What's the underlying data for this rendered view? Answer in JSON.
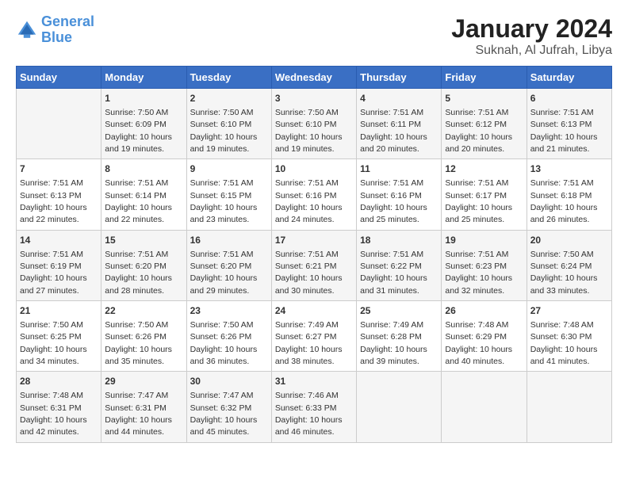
{
  "logo": {
    "line1": "General",
    "line2": "Blue"
  },
  "title": "January 2024",
  "subtitle": "Suknah, Al Jufrah, Libya",
  "days_header": [
    "Sunday",
    "Monday",
    "Tuesday",
    "Wednesday",
    "Thursday",
    "Friday",
    "Saturday"
  ],
  "weeks": [
    [
      {
        "day": "",
        "sunrise": "",
        "sunset": "",
        "daylight": ""
      },
      {
        "day": "1",
        "sunrise": "Sunrise: 7:50 AM",
        "sunset": "Sunset: 6:09 PM",
        "daylight": "Daylight: 10 hours and 19 minutes."
      },
      {
        "day": "2",
        "sunrise": "Sunrise: 7:50 AM",
        "sunset": "Sunset: 6:10 PM",
        "daylight": "Daylight: 10 hours and 19 minutes."
      },
      {
        "day": "3",
        "sunrise": "Sunrise: 7:50 AM",
        "sunset": "Sunset: 6:10 PM",
        "daylight": "Daylight: 10 hours and 19 minutes."
      },
      {
        "day": "4",
        "sunrise": "Sunrise: 7:51 AM",
        "sunset": "Sunset: 6:11 PM",
        "daylight": "Daylight: 10 hours and 20 minutes."
      },
      {
        "day": "5",
        "sunrise": "Sunrise: 7:51 AM",
        "sunset": "Sunset: 6:12 PM",
        "daylight": "Daylight: 10 hours and 20 minutes."
      },
      {
        "day": "6",
        "sunrise": "Sunrise: 7:51 AM",
        "sunset": "Sunset: 6:13 PM",
        "daylight": "Daylight: 10 hours and 21 minutes."
      }
    ],
    [
      {
        "day": "7",
        "sunrise": "Sunrise: 7:51 AM",
        "sunset": "Sunset: 6:13 PM",
        "daylight": "Daylight: 10 hours and 22 minutes."
      },
      {
        "day": "8",
        "sunrise": "Sunrise: 7:51 AM",
        "sunset": "Sunset: 6:14 PM",
        "daylight": "Daylight: 10 hours and 22 minutes."
      },
      {
        "day": "9",
        "sunrise": "Sunrise: 7:51 AM",
        "sunset": "Sunset: 6:15 PM",
        "daylight": "Daylight: 10 hours and 23 minutes."
      },
      {
        "day": "10",
        "sunrise": "Sunrise: 7:51 AM",
        "sunset": "Sunset: 6:16 PM",
        "daylight": "Daylight: 10 hours and 24 minutes."
      },
      {
        "day": "11",
        "sunrise": "Sunrise: 7:51 AM",
        "sunset": "Sunset: 6:16 PM",
        "daylight": "Daylight: 10 hours and 25 minutes."
      },
      {
        "day": "12",
        "sunrise": "Sunrise: 7:51 AM",
        "sunset": "Sunset: 6:17 PM",
        "daylight": "Daylight: 10 hours and 25 minutes."
      },
      {
        "day": "13",
        "sunrise": "Sunrise: 7:51 AM",
        "sunset": "Sunset: 6:18 PM",
        "daylight": "Daylight: 10 hours and 26 minutes."
      }
    ],
    [
      {
        "day": "14",
        "sunrise": "Sunrise: 7:51 AM",
        "sunset": "Sunset: 6:19 PM",
        "daylight": "Daylight: 10 hours and 27 minutes."
      },
      {
        "day": "15",
        "sunrise": "Sunrise: 7:51 AM",
        "sunset": "Sunset: 6:20 PM",
        "daylight": "Daylight: 10 hours and 28 minutes."
      },
      {
        "day": "16",
        "sunrise": "Sunrise: 7:51 AM",
        "sunset": "Sunset: 6:20 PM",
        "daylight": "Daylight: 10 hours and 29 minutes."
      },
      {
        "day": "17",
        "sunrise": "Sunrise: 7:51 AM",
        "sunset": "Sunset: 6:21 PM",
        "daylight": "Daylight: 10 hours and 30 minutes."
      },
      {
        "day": "18",
        "sunrise": "Sunrise: 7:51 AM",
        "sunset": "Sunset: 6:22 PM",
        "daylight": "Daylight: 10 hours and 31 minutes."
      },
      {
        "day": "19",
        "sunrise": "Sunrise: 7:51 AM",
        "sunset": "Sunset: 6:23 PM",
        "daylight": "Daylight: 10 hours and 32 minutes."
      },
      {
        "day": "20",
        "sunrise": "Sunrise: 7:50 AM",
        "sunset": "Sunset: 6:24 PM",
        "daylight": "Daylight: 10 hours and 33 minutes."
      }
    ],
    [
      {
        "day": "21",
        "sunrise": "Sunrise: 7:50 AM",
        "sunset": "Sunset: 6:25 PM",
        "daylight": "Daylight: 10 hours and 34 minutes."
      },
      {
        "day": "22",
        "sunrise": "Sunrise: 7:50 AM",
        "sunset": "Sunset: 6:26 PM",
        "daylight": "Daylight: 10 hours and 35 minutes."
      },
      {
        "day": "23",
        "sunrise": "Sunrise: 7:50 AM",
        "sunset": "Sunset: 6:26 PM",
        "daylight": "Daylight: 10 hours and 36 minutes."
      },
      {
        "day": "24",
        "sunrise": "Sunrise: 7:49 AM",
        "sunset": "Sunset: 6:27 PM",
        "daylight": "Daylight: 10 hours and 38 minutes."
      },
      {
        "day": "25",
        "sunrise": "Sunrise: 7:49 AM",
        "sunset": "Sunset: 6:28 PM",
        "daylight": "Daylight: 10 hours and 39 minutes."
      },
      {
        "day": "26",
        "sunrise": "Sunrise: 7:48 AM",
        "sunset": "Sunset: 6:29 PM",
        "daylight": "Daylight: 10 hours and 40 minutes."
      },
      {
        "day": "27",
        "sunrise": "Sunrise: 7:48 AM",
        "sunset": "Sunset: 6:30 PM",
        "daylight": "Daylight: 10 hours and 41 minutes."
      }
    ],
    [
      {
        "day": "28",
        "sunrise": "Sunrise: 7:48 AM",
        "sunset": "Sunset: 6:31 PM",
        "daylight": "Daylight: 10 hours and 42 minutes."
      },
      {
        "day": "29",
        "sunrise": "Sunrise: 7:47 AM",
        "sunset": "Sunset: 6:31 PM",
        "daylight": "Daylight: 10 hours and 44 minutes."
      },
      {
        "day": "30",
        "sunrise": "Sunrise: 7:47 AM",
        "sunset": "Sunset: 6:32 PM",
        "daylight": "Daylight: 10 hours and 45 minutes."
      },
      {
        "day": "31",
        "sunrise": "Sunrise: 7:46 AM",
        "sunset": "Sunset: 6:33 PM",
        "daylight": "Daylight: 10 hours and 46 minutes."
      },
      {
        "day": "",
        "sunrise": "",
        "sunset": "",
        "daylight": ""
      },
      {
        "day": "",
        "sunrise": "",
        "sunset": "",
        "daylight": ""
      },
      {
        "day": "",
        "sunrise": "",
        "sunset": "",
        "daylight": ""
      }
    ]
  ]
}
